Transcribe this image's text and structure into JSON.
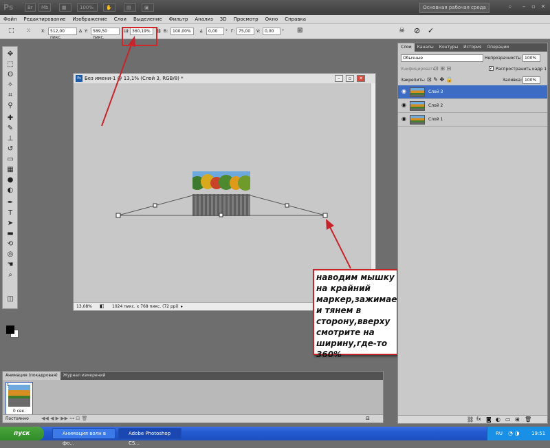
{
  "app": {
    "logo": "Ps",
    "zoom": "100%",
    "workspace": "Основная рабочая среда"
  },
  "menu": [
    "Файл",
    "Редактирование",
    "Изображение",
    "Слои",
    "Выделение",
    "Фильтр",
    "Анализ",
    "3D",
    "Просмотр",
    "Окно",
    "Справка"
  ],
  "options": {
    "x_label": "X:",
    "x_value": "512,00 пикс.",
    "y_label": "Y:",
    "y_value": "589,50 пикс.",
    "w_label": "Ш:",
    "w_value": "360,19%",
    "h_label": "В:",
    "h_value": "100,00%",
    "angle_value": "0,00",
    "hskew_label": "Г:",
    "hskew_value": "75,00",
    "vskew_label": "V:",
    "vskew_value": "0,00"
  },
  "document": {
    "title": "Без имени-1 @ 13,1% (Слой 3, RGB/8) *",
    "zoom": "13,08%",
    "size_info": "1024 пикс. x 768 пикс. (72 ppi)"
  },
  "annotation": "наводим мышку на крайний маркер,зажимаем и тянем в сторону,вверху смотрите на ширину,где-то 360%",
  "panel": {
    "tabs": [
      "Слои",
      "Каналы",
      "Контуры",
      "История",
      "Операции"
    ],
    "blend_mode": "Обычные",
    "opacity_label": "Непрозрачность:",
    "opacity_value": "100%",
    "unify_label": "Унифицировать:",
    "propagate_label": "Распространить кадр 1",
    "lock_label": "Закрепить:",
    "fill_label": "Заливка:",
    "fill_value": "100%",
    "layers": [
      "Слой 3",
      "Слой 2",
      "Слой 1"
    ]
  },
  "animation": {
    "tabs": [
      "Анимация (покадровая)",
      "Журнал измерений"
    ],
    "frame_number": "1",
    "frame_time": "0 сек.",
    "loop": "Постоянно"
  },
  "taskbar": {
    "start": "пуск",
    "tasks": [
      "Анимация волн в фо...",
      "Adobe Photoshop CS..."
    ],
    "lang": "RU",
    "time": "19:51"
  },
  "colors": {
    "accent": "#3960b9",
    "annotation_border": "#c6242a",
    "layer_selected": "#3d6cc4"
  }
}
